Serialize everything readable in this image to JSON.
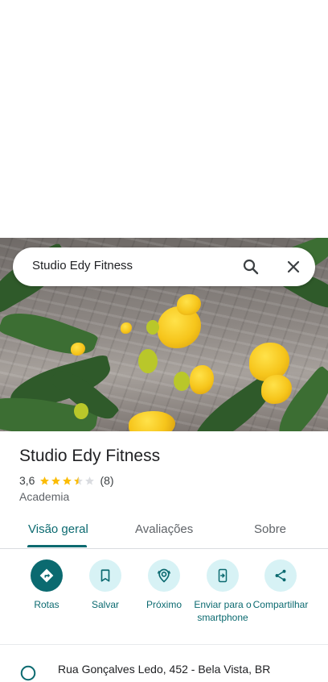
{
  "search": {
    "query": "Studio Edy Fitness"
  },
  "place": {
    "name": "Studio Edy Fitness",
    "rating": "3,6",
    "stars": 3.5,
    "review_count": "(8)",
    "category": "Academia"
  },
  "tabs": [
    {
      "label": "Visão geral",
      "active": true
    },
    {
      "label": "Avaliações",
      "active": false
    },
    {
      "label": "Sobre",
      "active": false
    }
  ],
  "actions": [
    {
      "label": "Rotas",
      "icon": "directions-icon"
    },
    {
      "label": "Salvar",
      "icon": "bookmark-icon"
    },
    {
      "label": "Próximo",
      "icon": "nearby-icon"
    },
    {
      "label": "Enviar para o smartphone",
      "icon": "send-to-phone-icon"
    },
    {
      "label": "Compartilhar",
      "icon": "share-icon"
    }
  ],
  "address": {
    "text": "Rua Gonçalves Ledo, 452 - Bela Vista, BR",
    "icon": "location-pin-icon"
  },
  "colors": {
    "accent": "#0b6a70",
    "accent_light": "#d7f2f5",
    "star": "#fbbc04",
    "star_empty": "#dadce0"
  }
}
